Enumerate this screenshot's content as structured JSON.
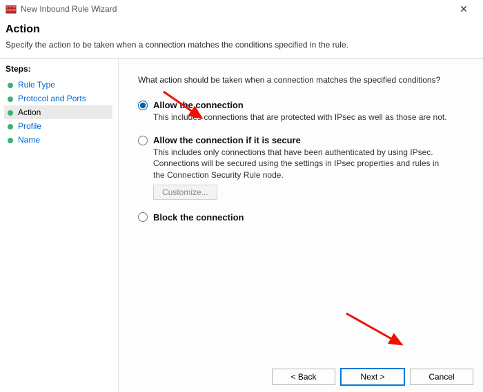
{
  "window": {
    "title": "New Inbound Rule Wizard"
  },
  "header": {
    "title": "Action",
    "description": "Specify the action to be taken when a connection matches the conditions specified in the rule."
  },
  "sidebar": {
    "heading": "Steps:",
    "items": [
      {
        "label": "Rule Type",
        "state": "link"
      },
      {
        "label": "Protocol and Ports",
        "state": "link"
      },
      {
        "label": "Action",
        "state": "current"
      },
      {
        "label": "Profile",
        "state": "link"
      },
      {
        "label": "Name",
        "state": "link"
      }
    ]
  },
  "main": {
    "prompt": "What action should be taken when a connection matches the specified conditions?",
    "options": [
      {
        "id": "allow",
        "label": "Allow the connection",
        "desc": "This includes connections that are protected with IPsec as well as those are not.",
        "selected": true
      },
      {
        "id": "allow-secure",
        "label": "Allow the connection if it is secure",
        "desc": "This includes only connections that have been authenticated by using IPsec.  Connections will be secured using the settings in IPsec properties and rules in the Connection Security Rule node.",
        "selected": false,
        "customize_label": "Customize..."
      },
      {
        "id": "block",
        "label": "Block the connection",
        "selected": false
      }
    ]
  },
  "footer": {
    "back": "< Back",
    "next": "Next >",
    "cancel": "Cancel"
  }
}
